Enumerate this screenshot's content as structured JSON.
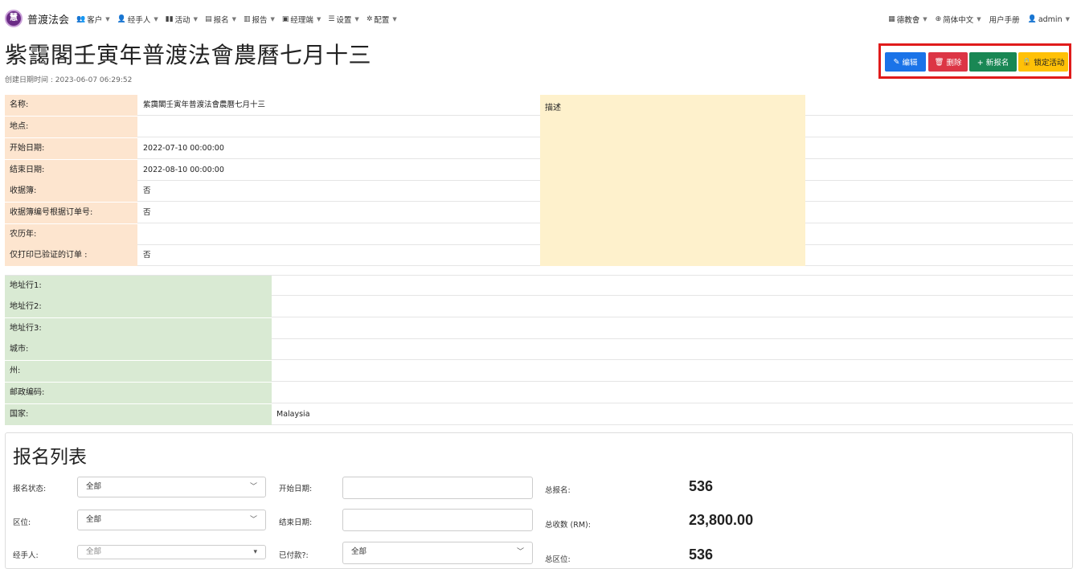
{
  "brand": {
    "logo_text": "慧",
    "name": "普渡法会"
  },
  "nav": [
    {
      "icon": "users-icon",
      "glyph": "👥",
      "label": "客户"
    },
    {
      "icon": "user-icon",
      "glyph": "👤",
      "label": "经手人"
    },
    {
      "icon": "columns-icon",
      "glyph": "▮▮",
      "label": "活动"
    },
    {
      "icon": "form-icon",
      "glyph": "▤",
      "label": "报名"
    },
    {
      "icon": "report-icon",
      "glyph": "▥",
      "label": "报告"
    },
    {
      "icon": "briefcase-icon",
      "glyph": "▣",
      "label": "经理端"
    },
    {
      "icon": "sliders-icon",
      "glyph": "☰",
      "label": "设置"
    },
    {
      "icon": "gear-icon",
      "glyph": "✲",
      "label": "配置"
    }
  ],
  "nav_right": {
    "org": "德教會",
    "language": "简体中文",
    "manual": "用户手册",
    "user": "admin"
  },
  "page": {
    "title": "紫靄閣壬寅年普渡法會農曆七月十三",
    "created": "创建日期时间 : 2023-06-07 06:29:52"
  },
  "actions": {
    "edit": "编辑",
    "delete": "删除",
    "new": "+ 新报名",
    "lock": "锁定活动"
  },
  "details": [
    {
      "label": "名称:",
      "value": "紫靄閣壬寅年普渡法會農曆七月十三"
    },
    {
      "label": "地点:",
      "value": ""
    },
    {
      "label": "开始日期:",
      "value": "2022-07-10 00:00:00"
    },
    {
      "label": "结束日期:",
      "value": "2022-08-10 00:00:00"
    },
    {
      "label": "收据簿:",
      "value": "否"
    },
    {
      "label": "收据簿编号根据订单号:",
      "value": "否"
    },
    {
      "label": "农历年:",
      "value": ""
    },
    {
      "label": "仅打印已验证的订单 :",
      "value": "否"
    }
  ],
  "description_label": "描述",
  "address": [
    {
      "label": "地址行1:",
      "value": ""
    },
    {
      "label": "地址行2:",
      "value": ""
    },
    {
      "label": "地址行3:",
      "value": ""
    },
    {
      "label": "城市:",
      "value": ""
    },
    {
      "label": "州:",
      "value": ""
    },
    {
      "label": "邮政编码:",
      "value": ""
    },
    {
      "label": "国家:",
      "value": "Malaysia"
    }
  ],
  "registration": {
    "title": "报名列表",
    "filters": {
      "status_label": "报名状态:",
      "status_value": "全部",
      "zone_label": "区位:",
      "zone_value": "全部",
      "agent_label": "经手人:",
      "agent_value": "全部",
      "start_label": "开始日期:",
      "end_label": "结束日期:",
      "paid_label": "已付款?:",
      "paid_value": "全部"
    },
    "stats": {
      "total_reg_label": "总报名:",
      "total_reg": "536",
      "total_amount_label": "总收数 (RM):",
      "total_amount": "23,800.00",
      "total_zone_label": "总区位:",
      "total_zone": "536"
    }
  }
}
